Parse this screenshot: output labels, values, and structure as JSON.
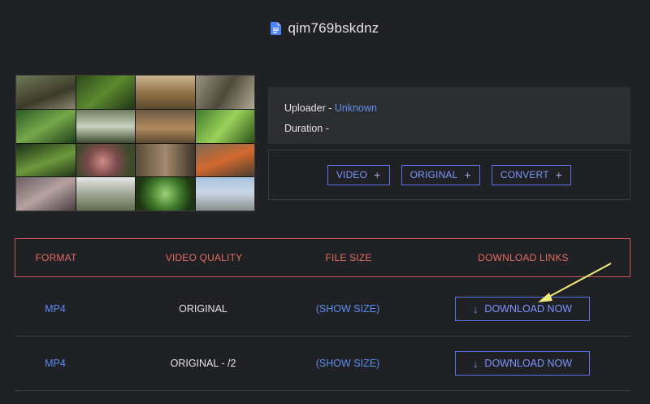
{
  "header": {
    "title": "qim769bskdnz",
    "icon": "document-icon"
  },
  "info": {
    "uploader_label": "Uploader - ",
    "uploader_value": "Unknown",
    "duration_label": "Duration -"
  },
  "options": {
    "video": "VIDEO",
    "original": "ORIGINAL",
    "convert": "CONVERT",
    "plus": "+"
  },
  "table": {
    "headers": [
      "FORMAT",
      "VIDEO QUALITY",
      "FILE SIZE",
      "DOWNLOAD LINKS"
    ],
    "rows": [
      {
        "format": "MP4",
        "quality": "ORIGINAL",
        "size": "(SHOW SIZE)",
        "download": "DOWNLOAD NOW"
      },
      {
        "format": "MP4",
        "quality": "ORIGINAL - /2",
        "size": "(SHOW SIZE)",
        "download": "DOWNLOAD NOW"
      }
    ]
  },
  "colors": {
    "background": "#202124",
    "accent": "#5b8def",
    "button_border": "#5b73e6",
    "header_red": "#e46b63",
    "annotation": "#f2ee7a"
  }
}
